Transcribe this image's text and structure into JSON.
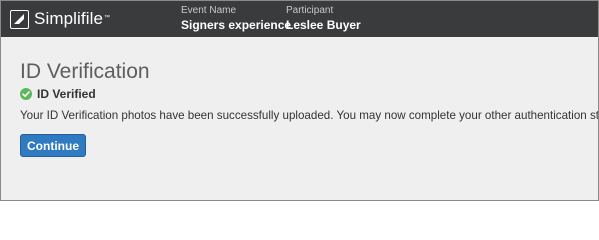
{
  "header": {
    "brand": "Simplifile",
    "brand_mark": "™",
    "event_label": "Event Name",
    "event_value": "Signers experience",
    "participant_label": "Participant",
    "participant_value": "Leslee Buyer"
  },
  "main": {
    "title": "ID Verification",
    "status": {
      "icon": "check-circle-icon",
      "label": "ID Verified",
      "color": "#5cb85c"
    },
    "message": "Your ID Verification photos have been successfully uploaded. You may now complete your other authentication steps.",
    "continue_label": "Continue"
  },
  "colors": {
    "topbar": "#3a3b3d",
    "background": "#efefef",
    "primary_button": "#2f7ac1"
  }
}
